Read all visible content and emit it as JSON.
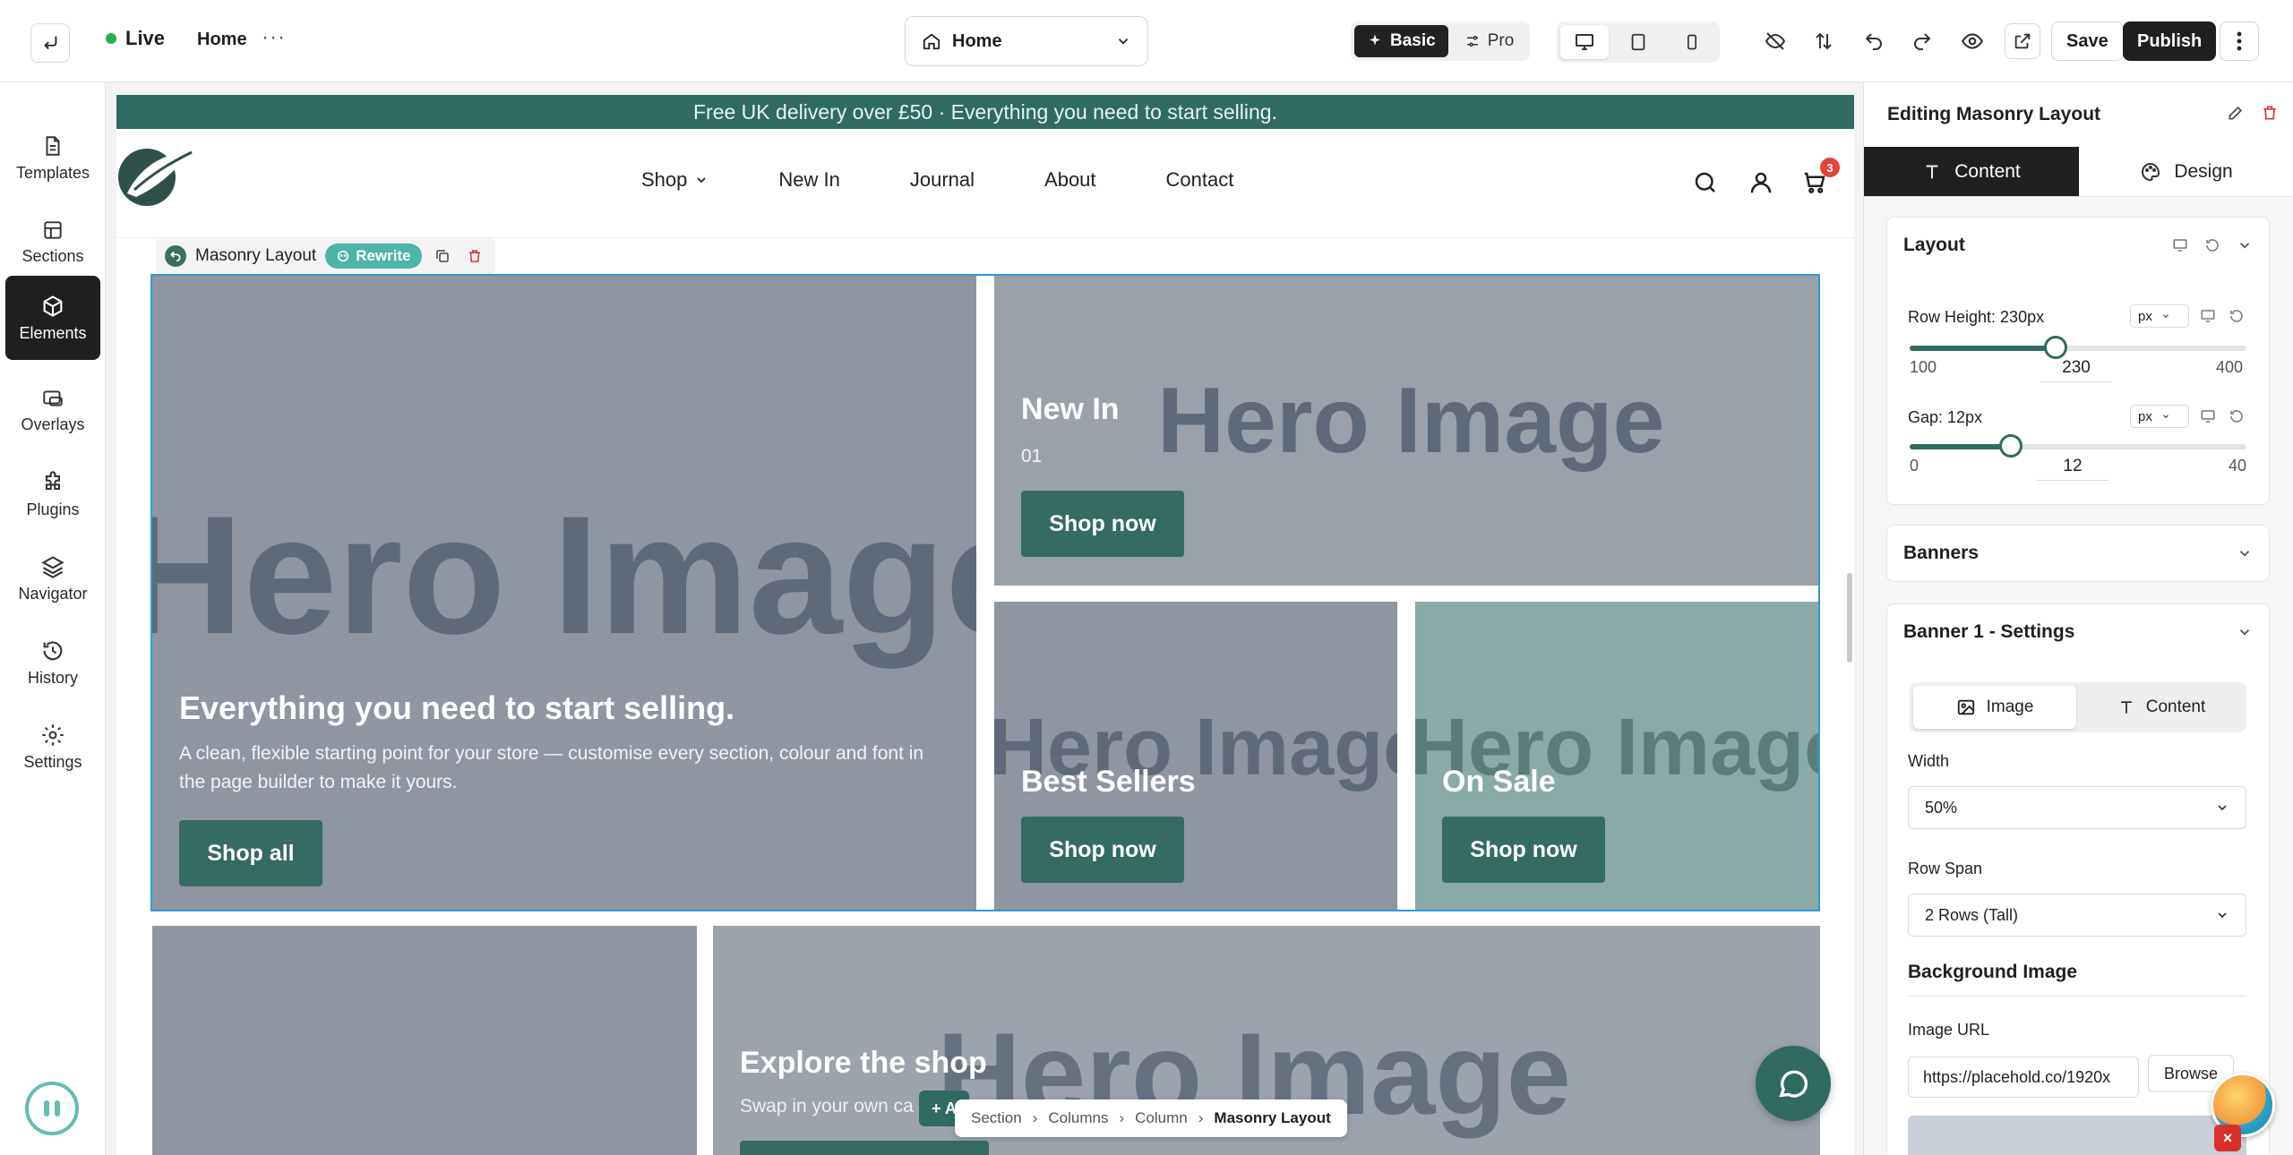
{
  "topbar": {
    "status": "Live",
    "breadcrumb_home": "Home",
    "more": "···",
    "page_select": "Home",
    "mode_basic": "Basic",
    "mode_pro": "Pro",
    "save": "Save",
    "publish": "Publish"
  },
  "sidebar": {
    "items": [
      {
        "label": "Templates",
        "icon": "document-icon"
      },
      {
        "label": "Sections",
        "icon": "layout-icon"
      },
      {
        "label": "Elements",
        "icon": "cube-icon"
      },
      {
        "label": "Overlays",
        "icon": "overlay-icon"
      },
      {
        "label": "Plugins",
        "icon": "puzzle-icon"
      },
      {
        "label": "Navigator",
        "icon": "layers-icon"
      },
      {
        "label": "History",
        "icon": "history-icon"
      },
      {
        "label": "Settings",
        "icon": "gear-icon"
      }
    ],
    "active": "Elements"
  },
  "site": {
    "announcement": "Free UK delivery over £50 · Everything you need to start selling.",
    "nav": [
      "Shop",
      "New In",
      "Journal",
      "About",
      "Contact"
    ],
    "cart_count": "3"
  },
  "element_toolbar": {
    "name": "Masonry Layout",
    "rewrite": "Rewrite"
  },
  "masonry": {
    "placeholder": "Hero Image",
    "hero": {
      "title": "Everything you need to start selling.",
      "subtitle": "A clean, flexible starting point for your store — customise every section, colour and font in the page builder to make it yours.",
      "button": "Shop all"
    },
    "new_in": {
      "title": "New In",
      "index": "01",
      "button": "Shop now"
    },
    "best_sellers": {
      "title": "Best Sellers",
      "button": "Shop now"
    },
    "on_sale": {
      "title": "On Sale",
      "button": "Shop now"
    }
  },
  "row2": {
    "title": "Explore the shop",
    "subtitle": "Swap in your own ca",
    "add_label": "+ A"
  },
  "breadcrumb": [
    "Section",
    "Columns",
    "Column",
    "Masonry Layout"
  ],
  "panel": {
    "title": "Editing Masonry Layout",
    "tab_content": "Content",
    "tab_design": "Design",
    "layout": {
      "header": "Layout",
      "row_height_label": "Row Height: 230px",
      "row_height_unit": "px",
      "row_height": {
        "min": "100",
        "max": "400",
        "value": "230",
        "fraction": 0.433
      },
      "gap_label": "Gap: 12px",
      "gap_unit": "px",
      "gap": {
        "min": "0",
        "max": "40",
        "value": "12",
        "fraction": 0.3
      }
    },
    "banners_header": "Banners",
    "banner1_header": "Banner 1 - Settings",
    "seg_image": "Image",
    "seg_content": "Content",
    "width_label": "Width",
    "width_value": "50%",
    "rowspan_label": "Row Span",
    "rowspan_value": "2 Rows (Tall)",
    "bg_title": "Background Image",
    "image_url_label": "Image URL",
    "image_url_value": "https://placehold.co/1920x",
    "browse": "Browse"
  },
  "colors": {
    "brand": "#2f6b60",
    "selection": "#2b9bd8",
    "accent": "#4cb5a5",
    "danger": "#e0443a"
  }
}
